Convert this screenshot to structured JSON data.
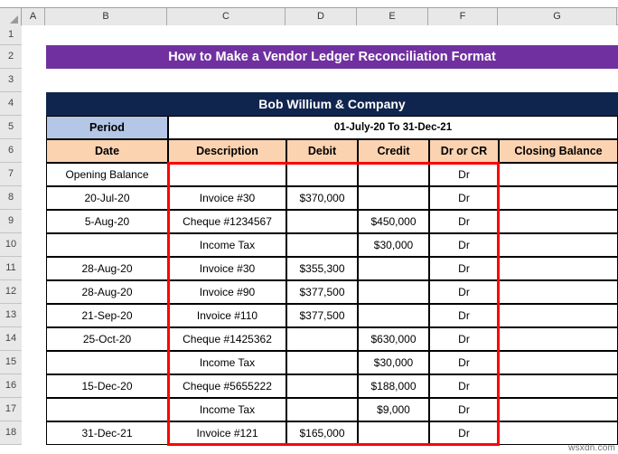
{
  "app": {
    "type": "spreadsheet",
    "watermark": "wsxdn.com"
  },
  "grid": {
    "column_headers": [
      "A",
      "B",
      "C",
      "D",
      "E",
      "F",
      "G"
    ],
    "row_headers": [
      "1",
      "2",
      "3",
      "4",
      "5",
      "6",
      "7",
      "8",
      "9",
      "10",
      "11",
      "12",
      "13",
      "14",
      "15",
      "16",
      "17",
      "18"
    ]
  },
  "colors": {
    "title_bar": "#7030A0",
    "company_bar": "#10254E",
    "period_label": "#B4C7E7",
    "header_row": "#FBD3B0",
    "highlight_border": "#FF0000",
    "header_text": "#FFFFFF"
  },
  "report": {
    "title": "How to Make a Vendor Ledger Reconciliation Format",
    "company": "Bob Willium & Company",
    "period_label": "Period",
    "period_value": "01-July-20 To 31-Dec-21",
    "columns": [
      "Date",
      "Description",
      "Debit",
      "Credit",
      "Dr or CR",
      "Closing Balance"
    ],
    "rows": [
      {
        "date": "Opening Balance",
        "description": "",
        "debit": "",
        "credit": "",
        "drcr": "Dr",
        "closing": ""
      },
      {
        "date": "20-Jul-20",
        "description": "Invoice #30",
        "debit": "$370,000",
        "credit": "",
        "drcr": "Dr",
        "closing": ""
      },
      {
        "date": "5-Aug-20",
        "description": "Cheque #1234567",
        "debit": "",
        "credit": "$450,000",
        "drcr": "Dr",
        "closing": ""
      },
      {
        "date": "",
        "description": "Income Tax",
        "debit": "",
        "credit": "$30,000",
        "drcr": "Dr",
        "closing": ""
      },
      {
        "date": "28-Aug-20",
        "description": "Invoice #30",
        "debit": "$355,300",
        "credit": "",
        "drcr": "Dr",
        "closing": ""
      },
      {
        "date": "28-Aug-20",
        "description": "Invoice #90",
        "debit": "$377,500",
        "credit": "",
        "drcr": "Dr",
        "closing": ""
      },
      {
        "date": "21-Sep-20",
        "description": "Invoice #110",
        "debit": "$377,500",
        "credit": "",
        "drcr": "Dr",
        "closing": ""
      },
      {
        "date": "25-Oct-20",
        "description": "Cheque #1425362",
        "debit": "",
        "credit": "$630,000",
        "drcr": "Dr",
        "closing": ""
      },
      {
        "date": "",
        "description": "Income Tax",
        "debit": "",
        "credit": "$30,000",
        "drcr": "Dr",
        "closing": ""
      },
      {
        "date": "15-Dec-20",
        "description": "Cheque #5655222",
        "debit": "",
        "credit": "$188,000",
        "drcr": "Dr",
        "closing": ""
      },
      {
        "date": "",
        "description": "Income Tax",
        "debit": "",
        "credit": "$9,000",
        "drcr": "Dr",
        "closing": ""
      },
      {
        "date": "31-Dec-21",
        "description": "Invoice #121",
        "debit": "$165,000",
        "credit": "",
        "drcr": "Dr",
        "closing": ""
      }
    ]
  }
}
